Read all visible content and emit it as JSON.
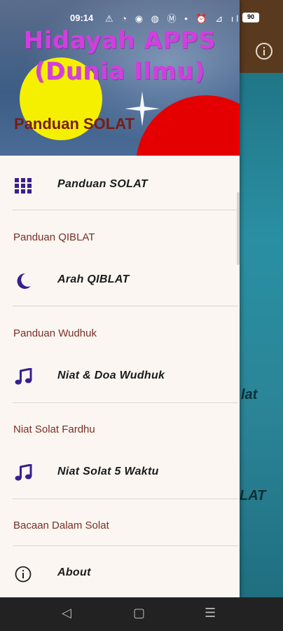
{
  "status_bar": {
    "time": "09:14",
    "icons": "⚠ ◔ ◉ ◍ Ⓜ •  ⏰ ⊿ ıl ıl",
    "battery": "90"
  },
  "background": {
    "text_1": "lat",
    "text_2": "LAT"
  },
  "drawer": {
    "header": {
      "title_line1": "Hidayah APPS",
      "title_line2": "(Dunia Ilmu)",
      "subtitle": "Panduan SOLAT"
    },
    "items": [
      {
        "label": "Panduan SOLAT",
        "icon": "grid-icon"
      },
      {
        "label": "Arah QIBLAT",
        "icon": "moon-icon"
      },
      {
        "label": "Niat & Doa Wudhuk",
        "icon": "music-note-icon"
      },
      {
        "label": "Niat Solat 5 Waktu",
        "icon": "music-note-icon"
      },
      {
        "label": "About",
        "icon": "info-icon"
      }
    ],
    "sections": [
      "Panduan QIBLAT",
      "Panduan Wudhuk",
      "Niat Solat Fardhu",
      "Bacaan Dalam Solat"
    ]
  },
  "nav_bar": {
    "back": "◁",
    "home": "▢",
    "recents": "☰"
  },
  "colors": {
    "icon_purple": "#3a1f8e",
    "section_text": "#7a2f25",
    "title_magenta": "#d23ee0",
    "drawer_bg": "#fbf6f2"
  }
}
